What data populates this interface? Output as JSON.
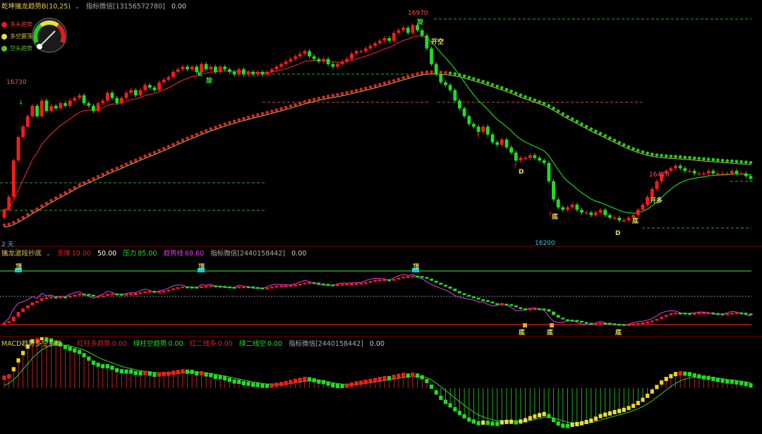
{
  "colors": {
    "up": "#ff1a1a",
    "down": "#22dd22",
    "ma_red": "#e02020",
    "ma_green": "#19d019",
    "yellow": "#f0e050",
    "magenta": "#e040e0",
    "cyan": "#00d0e0",
    "dash_green": "#2fa82f",
    "dash_orange": "#b06030",
    "grid": "#7a0000"
  },
  "main": {
    "header": {
      "title": "乾坤擒龙趋势B(10,25)",
      "wechat": "指标微信[13156572780]",
      "value": "0.00"
    },
    "legend": [
      {
        "label": "多头趋势",
        "color": "#e02020",
        "icon": "red-dot-icon"
      },
      {
        "label": "多空震荡",
        "color": "#e8e040",
        "icon": "yellow-dot-icon"
      },
      {
        "label": "空头趋势",
        "color": "#60c030",
        "icon": "green-dot-icon"
      }
    ],
    "gauge_icon": "speedometer-icon",
    "labels": {
      "high": "16970",
      "left_high": "16730",
      "low": "16200",
      "mid_high": "16410",
      "period": "2 天"
    },
    "signals": {
      "k": "K",
      "xuan1": "旋",
      "xuan2": "旋",
      "kaikong": "开空",
      "kaiduo": "开多",
      "d1": "D",
      "d2": "D",
      "di1": "底",
      "di2": "底"
    }
  },
  "osc": {
    "header": {
      "title": "擒龙波段抄底",
      "support_label": "支撑",
      "support_value": "10.00",
      "mid_value": "50.00",
      "resist_label": "压力",
      "resist_value": "85.00",
      "trend_label": "趋势线",
      "trend_value": "68.60",
      "wechat": "指标微信[2440158442]",
      "value": "0.00"
    },
    "signals": {
      "t1": "顶",
      "t2": "顶",
      "t3": "顶",
      "b1": "底",
      "b2": "底",
      "b3": "底"
    }
  },
  "macd": {
    "header": {
      "title": "MACD趋势多空系统",
      "s1_label": "红柱多趋势",
      "s1_value": "0.00",
      "s2_label": "绿柱空趋势",
      "s2_value": "0.00",
      "s3_label": "红二线多",
      "s3_value": "0.00",
      "s4_label": "绿二线空",
      "s4_value": "0.00",
      "wechat": "指标微信[2440158442]",
      "value": "0.00"
    }
  },
  "chart_data": {
    "type": "candlestick",
    "title": "乾坤擒龙趋势B(10,25)",
    "price_range": [
      16130,
      17030
    ],
    "labels": {
      "high": 16970,
      "left_high": 16730,
      "low": 16200,
      "mid_high": 16410
    },
    "closes": [
      16240,
      16290,
      16430,
      16520,
      16560,
      16600,
      16640,
      16600,
      16660,
      16620,
      16640,
      16630,
      16650,
      16640,
      16660,
      16670,
      16680,
      16650,
      16640,
      16620,
      16650,
      16660,
      16690,
      16670,
      16650,
      16670,
      16690,
      16700,
      16680,
      16700,
      16720,
      16710,
      16700,
      16730,
      16740,
      16750,
      16770,
      16780,
      16790,
      16780,
      16790,
      16770,
      16800,
      16780,
      16790,
      16770,
      16790,
      16780,
      16770,
      16760,
      16780,
      16760,
      16770,
      16760,
      16770,
      16760,
      16770,
      16780,
      16790,
      16800,
      16810,
      16820,
      16830,
      16840,
      16850,
      16830,
      16820,
      16810,
      16820,
      16800,
      16790,
      16800,
      16810,
      16820,
      16840,
      16850,
      16850,
      16860,
      16870,
      16880,
      16890,
      16900,
      16890,
      16920,
      16930,
      16940,
      16920,
      16950,
      16930,
      16910,
      16860,
      16800,
      16760,
      16730,
      16720,
      16700,
      16660,
      16630,
      16600,
      16570,
      16560,
      16540,
      16560,
      16530,
      16500,
      16490,
      16510,
      16480,
      16460,
      16430,
      16440,
      16440,
      16450,
      16440,
      16430,
      16420,
      16350,
      16280,
      16250,
      16240,
      16250,
      16260,
      16240,
      16230,
      16230,
      16220,
      16230,
      16240,
      16220,
      16210,
      16210,
      16200,
      16200,
      16210,
      16220,
      16240,
      16260,
      16290,
      16320,
      16350,
      16380,
      16390,
      16400,
      16410,
      16400,
      16390,
      16390,
      16380,
      16380,
      16380,
      16390,
      16380,
      16380,
      16380,
      16380,
      16390,
      16380,
      16380,
      16370,
      16360
    ]
  }
}
